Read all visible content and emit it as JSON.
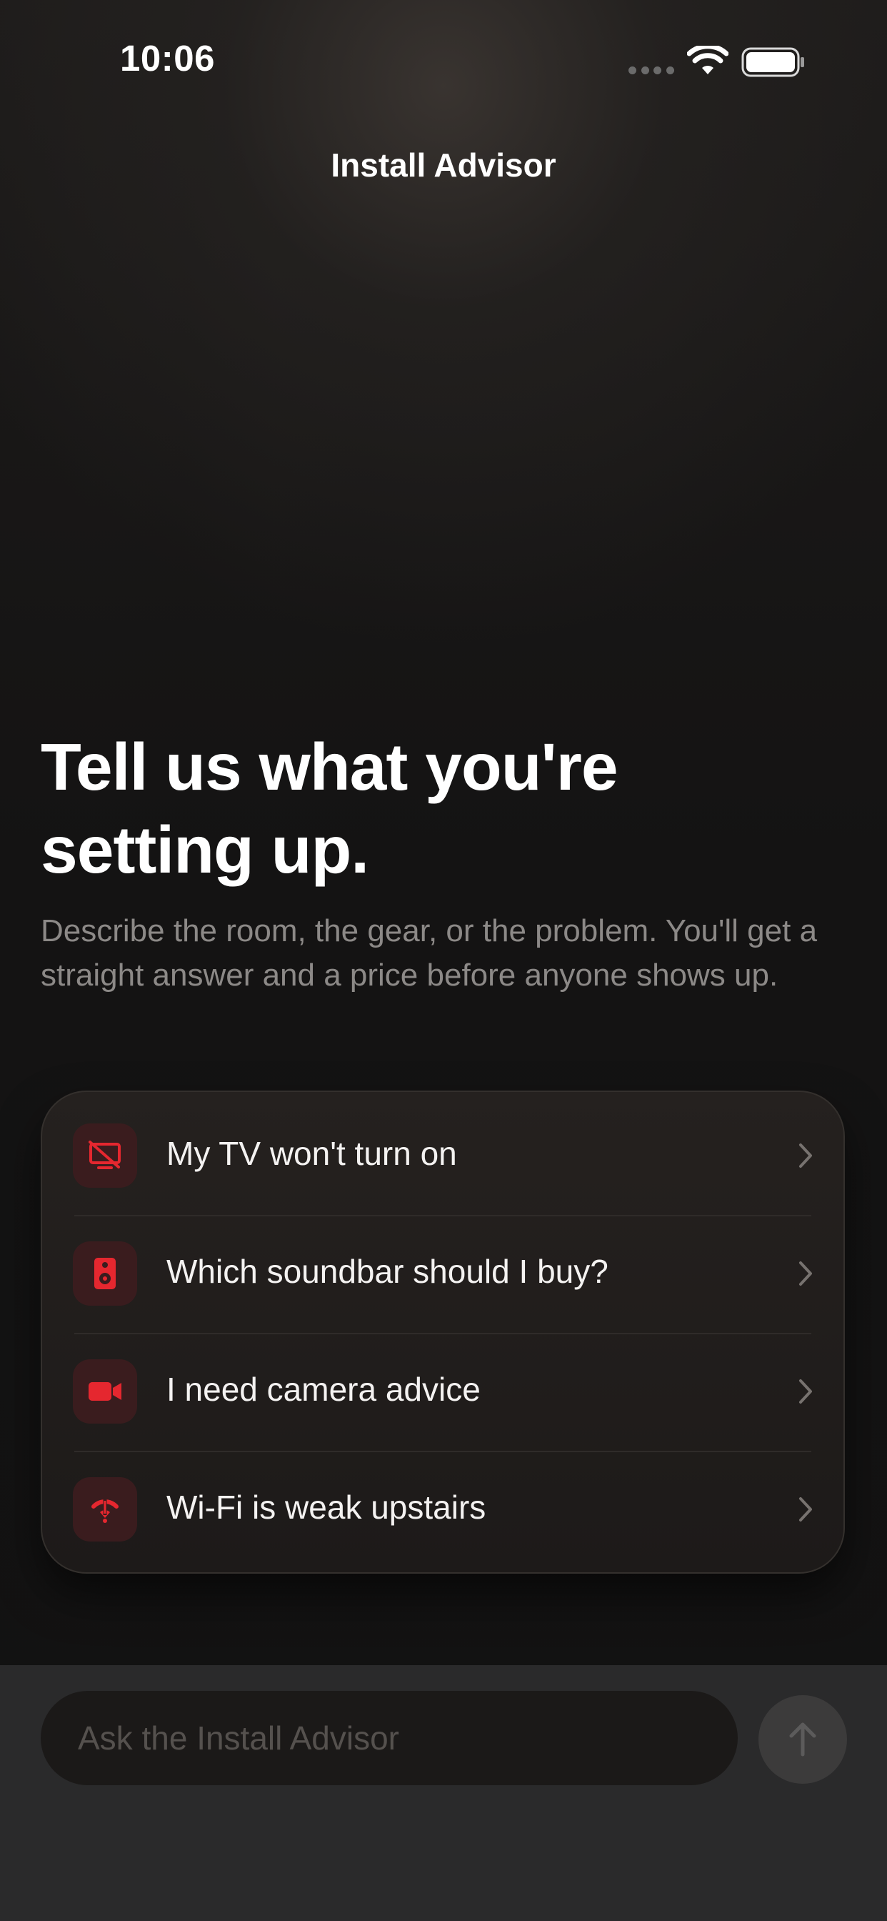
{
  "status_bar": {
    "time": "10:06",
    "icons": [
      "cellular-dots-icon",
      "wifi-icon",
      "battery-icon"
    ]
  },
  "nav": {
    "title": "Install Advisor"
  },
  "hero": {
    "title": "Tell us what you're setting up.",
    "subtitle": "Describe the room, the gear, or the problem. You'll get a straight answer and a price before anyone shows up."
  },
  "suggestions": [
    {
      "label": "My TV won't turn on",
      "icon": "tv-off-icon"
    },
    {
      "label": "Which soundbar should I buy?",
      "icon": "speaker-icon"
    },
    {
      "label": "I need camera advice",
      "icon": "video-camera-icon"
    },
    {
      "label": "Wi-Fi is weak upstairs",
      "icon": "wifi-weak-icon"
    }
  ],
  "composer": {
    "placeholder": "Ask the Install Advisor",
    "value": "",
    "send_icon": "arrow-up-icon"
  },
  "colors": {
    "accent": "#e5272f",
    "icon_tile": "#3a1c1e",
    "card": "#221f1d",
    "subtitle_text": "#8c8987",
    "composer_bar": "#2a2a2b"
  }
}
